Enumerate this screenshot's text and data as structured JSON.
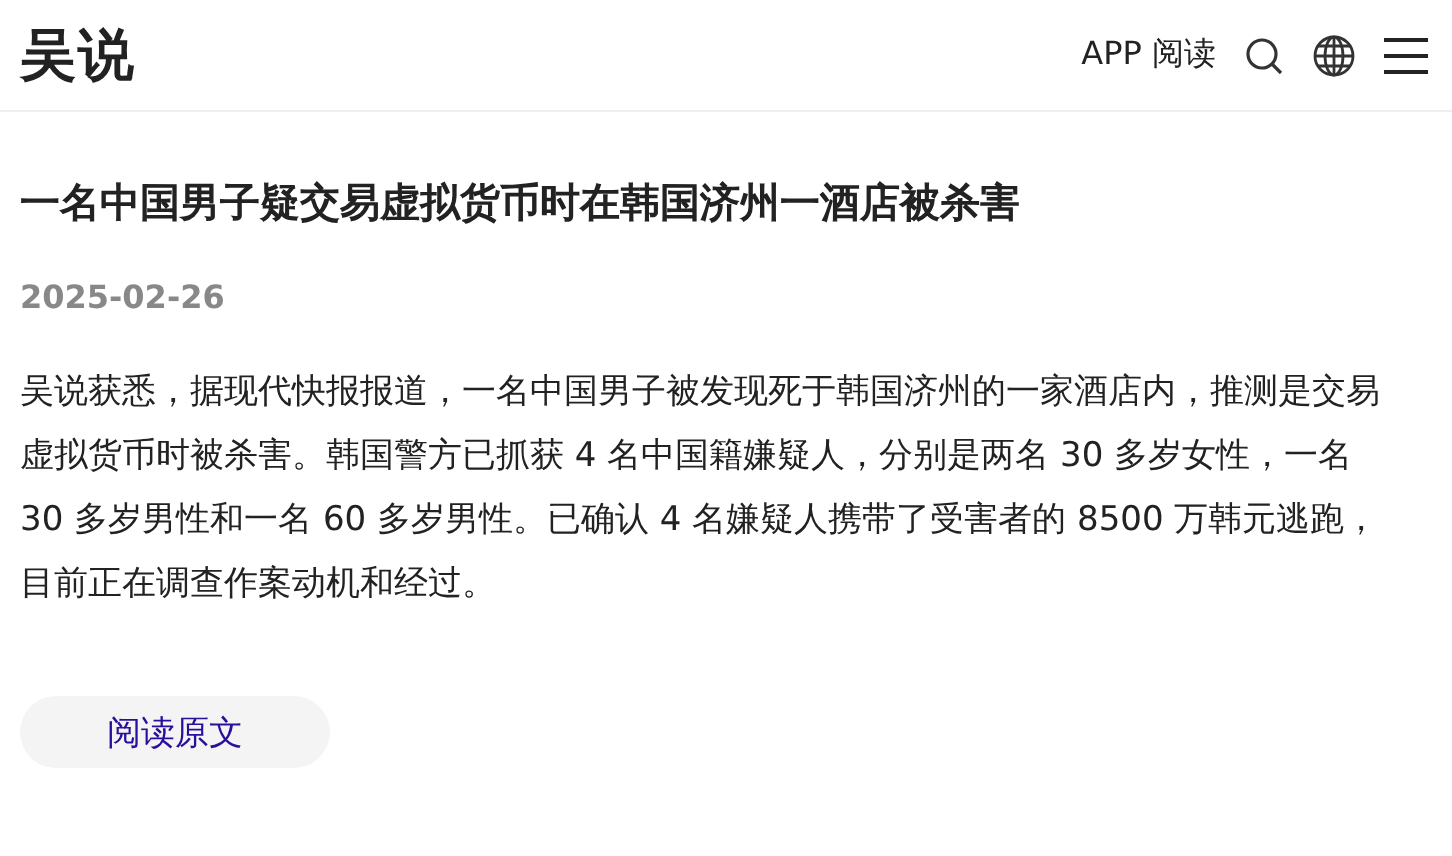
{
  "header": {
    "logo": "吴说",
    "app_link": "APP 阅读"
  },
  "article": {
    "title": "一名中国男子疑交易虚拟货币时在韩国济州一酒店被杀害",
    "date": "2025-02-26",
    "body": "吴说获悉，据现代快报报道，一名中国男子被发现死于韩国济州的一家酒店内，推测是交易虚拟货币时被杀害。韩国警方已抓获 4 名中国籍嫌疑人，分别是两名 30 多岁女性，一名 30 多岁男性和一名 60 多岁男性。已确认 4 名嫌疑人携带了受害者的 8500 万韩元逃跑，目前正在调查作案动机和经过。",
    "button": "阅读原文"
  }
}
